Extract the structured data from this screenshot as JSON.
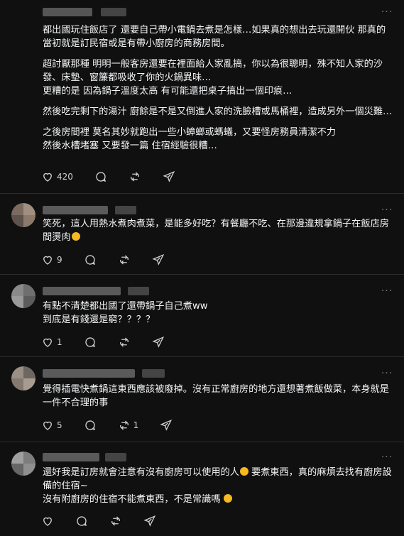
{
  "posts": [
    {
      "paragraphs": [
        "都出國玩住飯店了 還要自己帶小電鍋去煮是怎樣…如果真的想出去玩還開伙 那真的當初就是訂民宿或是有帶小廚房的商務房間。",
        "超討厭那種 明明一般客房還要在裡面給人家亂搞，你以為很聰明，殊不知人家的沙發、床墊、窗簾都吸收了你的火鍋異味…\n更糟的是 因為鍋子溫度太高 有可能還把桌子搞出一個印痕…",
        "然後吃完剩下的湯汁 廚餘是不是又倒進人家的洗臉槽或馬桶裡，造成另外一個災難…",
        "之後房間裡 莫名其妙就跑出一些小蟑螂或螞蟻，又要怪房務員清潔不力\n然後水槽堵塞 又要發一篇 住宿經驗很糟…"
      ],
      "likes": "420",
      "comments": "",
      "reposts": "",
      "shares": ""
    },
    {
      "paragraphs": [
        "笑死，這人用熱水煮肉煮菜，是能多好吃？有餐廳不吃、在那邊違規拿鍋子在飯店房間燙肉"
      ],
      "emoji_end": "laugh",
      "likes": "9",
      "comments": "",
      "reposts": "",
      "shares": ""
    },
    {
      "paragraphs": [
        "有點不清楚都出國了還帶鍋子自己煮ww\n到底是有錢還是窮？？？？"
      ],
      "likes": "1",
      "comments": "",
      "reposts": "",
      "shares": ""
    },
    {
      "paragraphs": [
        "覺得插電快煮鍋這東西應該被廢掉。沒有正常廚房的地方還想著煮飯做菜，本身就是一件不合理的事"
      ],
      "likes": "5",
      "comments": "",
      "reposts": "1",
      "shares": ""
    },
    {
      "paragraphs_rich": [
        {
          "before": "還好我是訂房就會注意有沒有廚房可以使用的人",
          "emoji": "smile",
          "after": "要煮東西，真的麻煩去找有廚房設備的住宿~"
        },
        {
          "before": "沒有附廚房的住宿不能煮東西，不是常識嗎",
          "emoji": "think",
          "after": ""
        }
      ],
      "likes": "",
      "comments": "",
      "reposts": "",
      "shares": ""
    }
  ],
  "icons": {
    "like": "heart-outline-icon",
    "comment": "speech-bubble-icon",
    "repost": "repost-arrows-icon",
    "share": "paper-plane-icon",
    "more": "more-dots-icon"
  },
  "more_glyph": "···",
  "colors": {
    "background": "#101010",
    "text": "#f3f5f7",
    "muted": "#cfcfcf",
    "divider": "#2d2d2d",
    "emoji": "#f5b921"
  }
}
